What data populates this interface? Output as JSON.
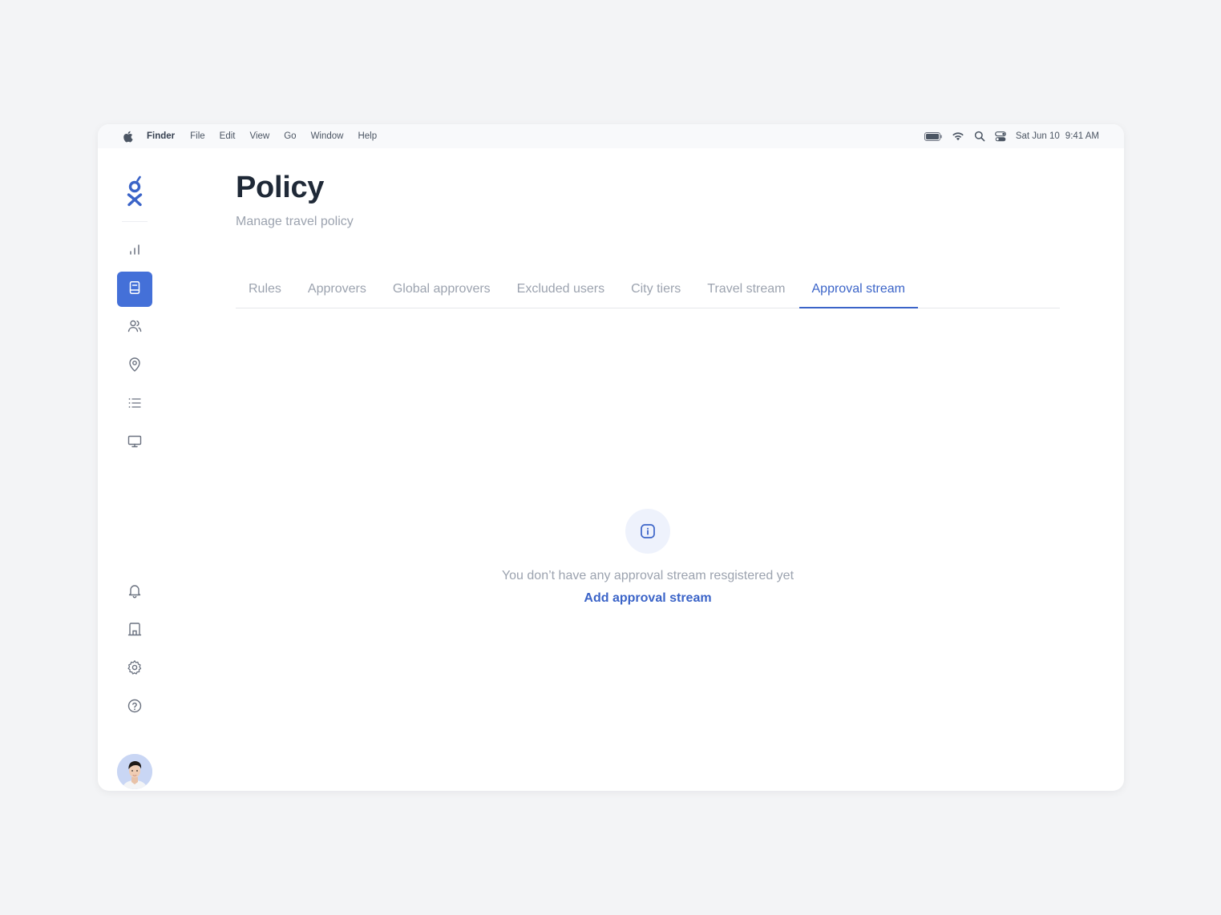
{
  "menubar": {
    "app_name": "Finder",
    "items": [
      "File",
      "Edit",
      "View",
      "Go",
      "Window",
      "Help"
    ],
    "date": "Sat Jun 10",
    "time": "9:41 AM",
    "status_icons": [
      "battery-icon",
      "wifi-icon",
      "spotlight-search-icon",
      "control-center-icon"
    ]
  },
  "sidebar": {
    "top_items": [
      {
        "icon": "bar-chart-icon",
        "active": false
      },
      {
        "icon": "policy-book-icon",
        "active": true
      },
      {
        "icon": "users-icon",
        "active": false
      },
      {
        "icon": "location-pin-icon",
        "active": false
      },
      {
        "icon": "list-icon",
        "active": false
      },
      {
        "icon": "monitor-icon",
        "active": false
      }
    ],
    "bottom_items": [
      {
        "icon": "bell-icon"
      },
      {
        "icon": "building-icon"
      },
      {
        "icon": "gear-icon"
      },
      {
        "icon": "help-circle-icon"
      }
    ]
  },
  "page": {
    "title": "Policy",
    "subtitle": "Manage travel policy"
  },
  "tabs": [
    {
      "label": "Rules",
      "active": false
    },
    {
      "label": "Approvers",
      "active": false
    },
    {
      "label": "Global approvers",
      "active": false
    },
    {
      "label": "Excluded users",
      "active": false
    },
    {
      "label": "City tiers",
      "active": false
    },
    {
      "label": "Travel stream",
      "active": false
    },
    {
      "label": "Approval stream",
      "active": true
    }
  ],
  "empty_state": {
    "message": "You don’t have any approval stream resgistered yet",
    "action_label": "Add approval stream"
  },
  "colors": {
    "accent": "#3b64c8",
    "active_nav_bg": "#4470d8",
    "muted_text": "#9ca3af",
    "title_text": "#1f2937"
  }
}
